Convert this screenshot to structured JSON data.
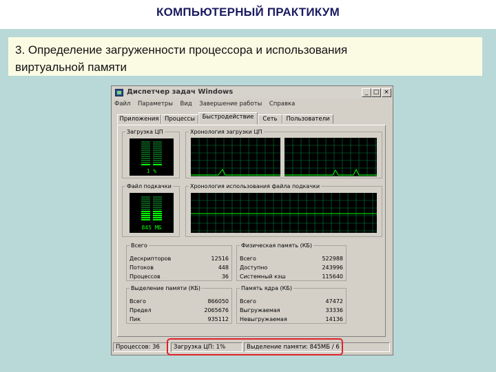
{
  "slide": {
    "header": "КОМПЬЮТЕРНЫЙ ПРАКТИКУМ",
    "caption_line1": "3. Определение загруженности процессора и использования",
    "caption_line2": "виртуальной памяти"
  },
  "window": {
    "title": "Диспетчер задач Windows",
    "buttons": {
      "minimize": "_",
      "maximize": "□",
      "close": "×"
    },
    "menu": [
      "Файл",
      "Параметры",
      "Вид",
      "Завершение работы",
      "Справка"
    ],
    "tabs": [
      "Приложения",
      "Процессы",
      "Быстродействие",
      "Сеть",
      "Пользователи"
    ],
    "active_tab": "Быстродействие",
    "cpu_usage": {
      "title": "Загрузка ЦП",
      "value": "1 %",
      "level": 0.01
    },
    "cpu_history": {
      "title": "Хронология загрузки ЦП"
    },
    "pagefile": {
      "title": "Файл подкачки",
      "value": "845 МБ",
      "level": 0.45
    },
    "pagefile_history": {
      "title": "Хронология использования файла подкачки"
    },
    "totals": {
      "title": "Всего",
      "rows": [
        {
          "label": "Дескрипторов",
          "value": "12516"
        },
        {
          "label": "Потоков",
          "value": "448"
        },
        {
          "label": "Процессов",
          "value": "36"
        }
      ]
    },
    "physical": {
      "title": "Физическая память (КБ)",
      "rows": [
        {
          "label": "Всего",
          "value": "522988"
        },
        {
          "label": "Доступно",
          "value": "243996"
        },
        {
          "label": "Системный кэш",
          "value": "115640"
        }
      ]
    },
    "commit": {
      "title": "Выделение памяти (КБ)",
      "rows": [
        {
          "label": "Всего",
          "value": "866050"
        },
        {
          "label": "Предел",
          "value": "2065676"
        },
        {
          "label": "Пик",
          "value": "935112"
        }
      ]
    },
    "kernel": {
      "title": "Память ядра (КБ)",
      "rows": [
        {
          "label": "Всего",
          "value": "47472"
        },
        {
          "label": "Выгружаемая",
          "value": "33336"
        },
        {
          "label": "Невыгружаемая",
          "value": "14136"
        }
      ]
    },
    "statusbar": {
      "processes": "Процессов: 36",
      "cpu": "Загрузка ЦП: 1%",
      "commit": "Выделение памяти: 845МБ / 6"
    }
  },
  "colors": {
    "graph_line": "#00ff00",
    "grid": "#008040",
    "highlight": "#e0202a"
  }
}
